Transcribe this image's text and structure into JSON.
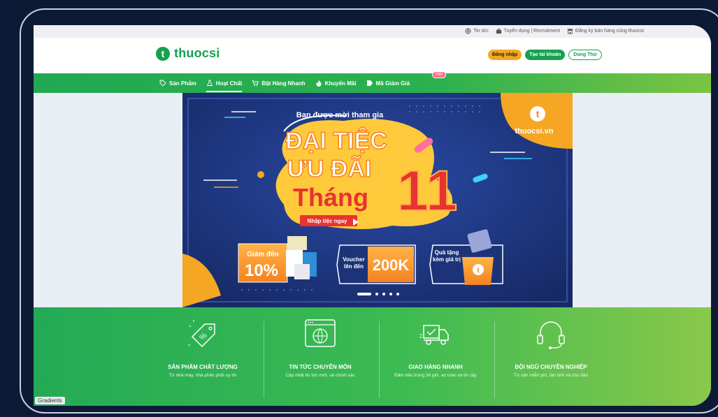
{
  "topbar": {
    "links": [
      {
        "icon": "globe-icon",
        "label": "Tin tức"
      },
      {
        "icon": "briefcase-icon",
        "label": "Tuyển dụng | Recruitment"
      },
      {
        "icon": "store-icon",
        "label": "Đăng ký bán hàng cùng thuocsi"
      }
    ]
  },
  "header": {
    "logo_letter": "t",
    "logo_text": "thuocsi",
    "login_label": "Đăng nhập",
    "signup_label": "Tạo tài khoản",
    "trial_label": "Dùng Thử"
  },
  "nav": {
    "items": [
      {
        "icon": "tag-icon",
        "label": "Sản Phẩm"
      },
      {
        "icon": "flask-icon",
        "label": "Hoạt Chất"
      },
      {
        "icon": "cart-icon",
        "label": "Đặt Hàng Nhanh"
      },
      {
        "icon": "fire-icon",
        "label": "Khuyến Mãi"
      },
      {
        "icon": "coupon-icon",
        "label": "Mã Giảm Giá"
      }
    ],
    "active_index": 1,
    "new_badge": "Mới"
  },
  "banner": {
    "invite": "Bạn được mời tham gia",
    "line1": "ĐẠI TIỆC",
    "line2": "ƯU ĐÃI",
    "line3": "Tháng",
    "number": "11",
    "cta": "Nhập tiệc ngay",
    "brand_letter": "t",
    "brand": "thuocsi.vn",
    "promo1_top": "Giảm đến",
    "promo1_value": "10%",
    "promo2_label": "Voucher lên đến",
    "promo2_value": "200K",
    "promo3_label": "Quà tặng kèm giá trị",
    "promo3_letter": "t",
    "carousel_count": 5,
    "carousel_active": 0
  },
  "features": [
    {
      "icon": "tag-percent-icon",
      "title": "SẢN PHẨM CHẤT LƯỢNG",
      "desc": "Từ nhà máy, nhà phân phối uy tín"
    },
    {
      "icon": "browser-globe-icon",
      "title": "TIN TỨC CHUYÊN MÔN",
      "desc": "Cập nhật tin tức mới, và chính xác"
    },
    {
      "icon": "delivery-truck-icon",
      "title": "GIAO HÀNG NHANH",
      "desc": "Đảm bảo trong 36 giờ, an toàn và tin cậy"
    },
    {
      "icon": "headset-icon",
      "title": "ĐỘI NGŨ CHUYÊN NGHIỆP",
      "desc": "Tư vấn miễn phí, tận tình và chu đáo"
    }
  ],
  "corner_label": "Gradients",
  "colors": {
    "brand_green": "#15a150",
    "accent_orange": "#f5a623",
    "banner_navy": "#1d3378"
  }
}
